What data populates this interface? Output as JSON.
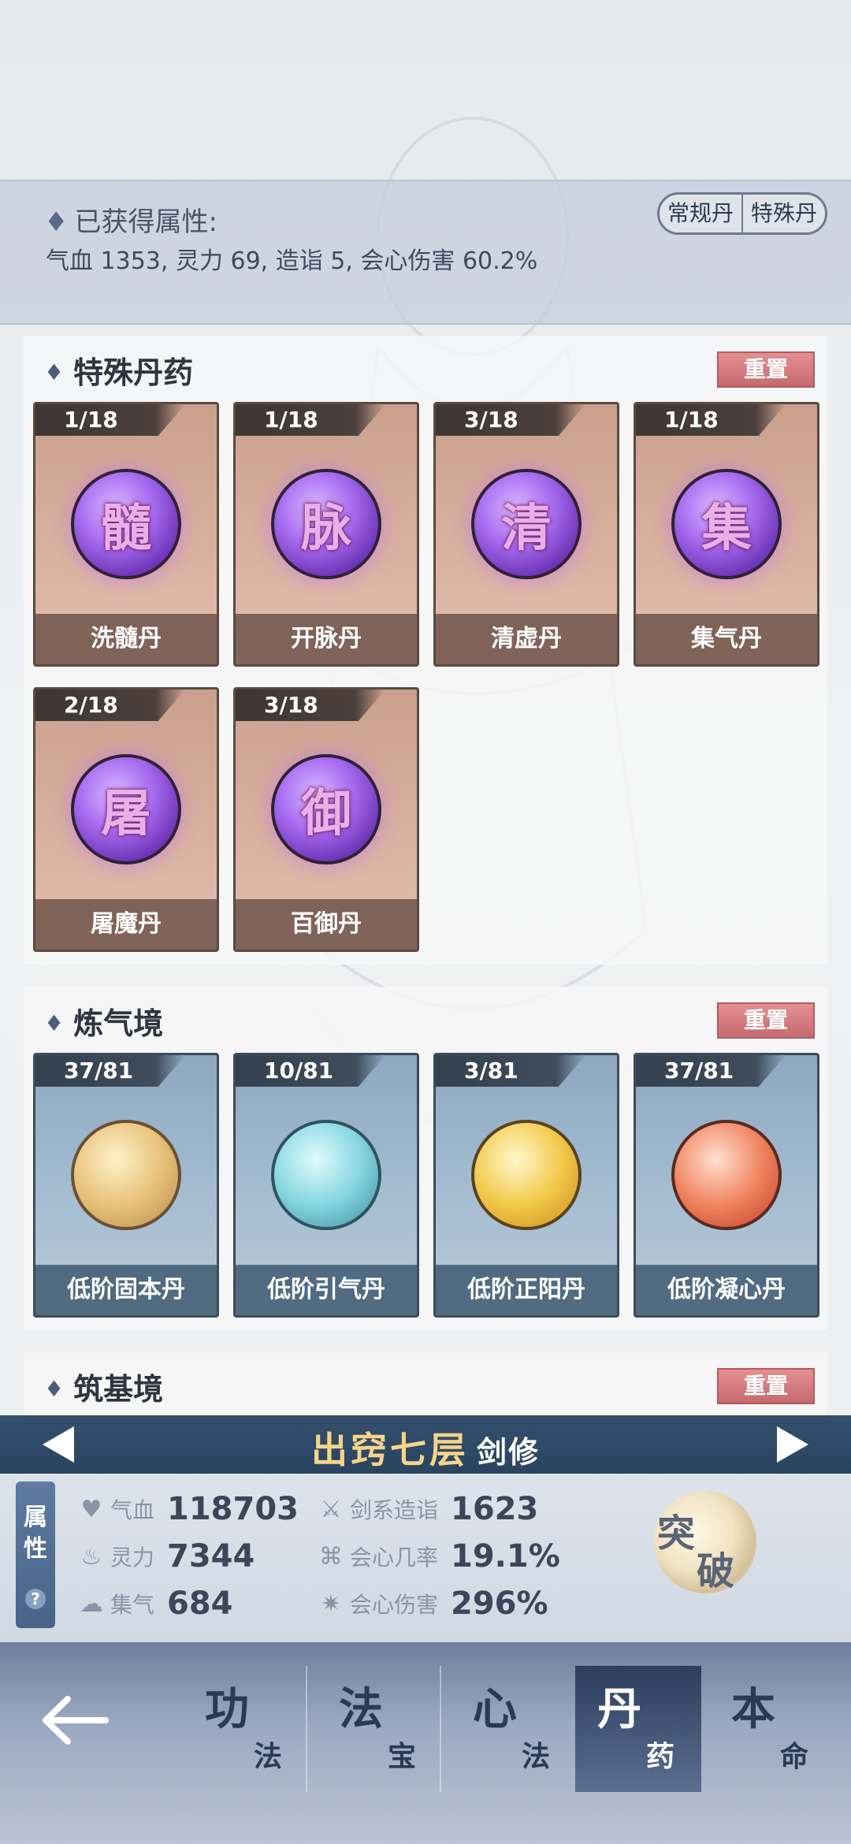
{
  "attributes": {
    "title": "已获得属性:",
    "values": "气血 1353, 灵力 69, 造诣 5, 会心伤害 60.2%",
    "switch": [
      "常规丹",
      "特殊丹"
    ]
  },
  "special_section": {
    "title": "特殊丹药",
    "reset_label": "重置",
    "items": [
      {
        "count": "1/18",
        "glyph": "髓",
        "name": "洗髓丹"
      },
      {
        "count": "1/18",
        "glyph": "脉",
        "name": "开脉丹"
      },
      {
        "count": "3/18",
        "glyph": "清",
        "name": "清虚丹"
      },
      {
        "count": "1/18",
        "glyph": "集",
        "name": "集气丹"
      },
      {
        "count": "2/18",
        "glyph": "屠",
        "name": "屠魔丹"
      },
      {
        "count": "3/18",
        "glyph": "御",
        "name": "百御丹"
      }
    ]
  },
  "qi_section": {
    "title": "炼气境",
    "reset_label": "重置",
    "items": [
      {
        "count": "37/81",
        "name": "低阶固本丹",
        "orb": "gold"
      },
      {
        "count": "10/81",
        "name": "低阶引气丹",
        "orb": "teal"
      },
      {
        "count": "3/81",
        "name": "低阶正阳丹",
        "orb": "yellow"
      },
      {
        "count": "37/81",
        "name": "低阶凝心丹",
        "orb": "red"
      }
    ]
  },
  "foundation_section": {
    "title": "筑基境",
    "reset_label": "重置"
  },
  "level": {
    "title": "出窍七层",
    "subtitle": "剑修"
  },
  "stats": {
    "tab_top": "属",
    "tab_bottom": "性",
    "help": "?",
    "qixue_label": "气血",
    "qixue_value": "118703",
    "lingli_label": "灵力",
    "lingli_value": "7344",
    "jiqi_label": "集气",
    "jiqi_value": "684",
    "jianxi_label": "剑系造诣",
    "jianxi_value": "1623",
    "huixin_rate_label": "会心几率",
    "huixin_rate_value": "19.1%",
    "huixin_dmg_label": "会心伤害",
    "huixin_dmg_value": "296%",
    "breakthrough_1": "突",
    "breakthrough_2": "破"
  },
  "nav": {
    "items": [
      {
        "big": "功",
        "small": "法"
      },
      {
        "big": "法",
        "small": "宝"
      },
      {
        "big": "心",
        "small": "法"
      },
      {
        "big": "丹",
        "small": "药"
      },
      {
        "big": "本",
        "small": "命"
      }
    ]
  }
}
